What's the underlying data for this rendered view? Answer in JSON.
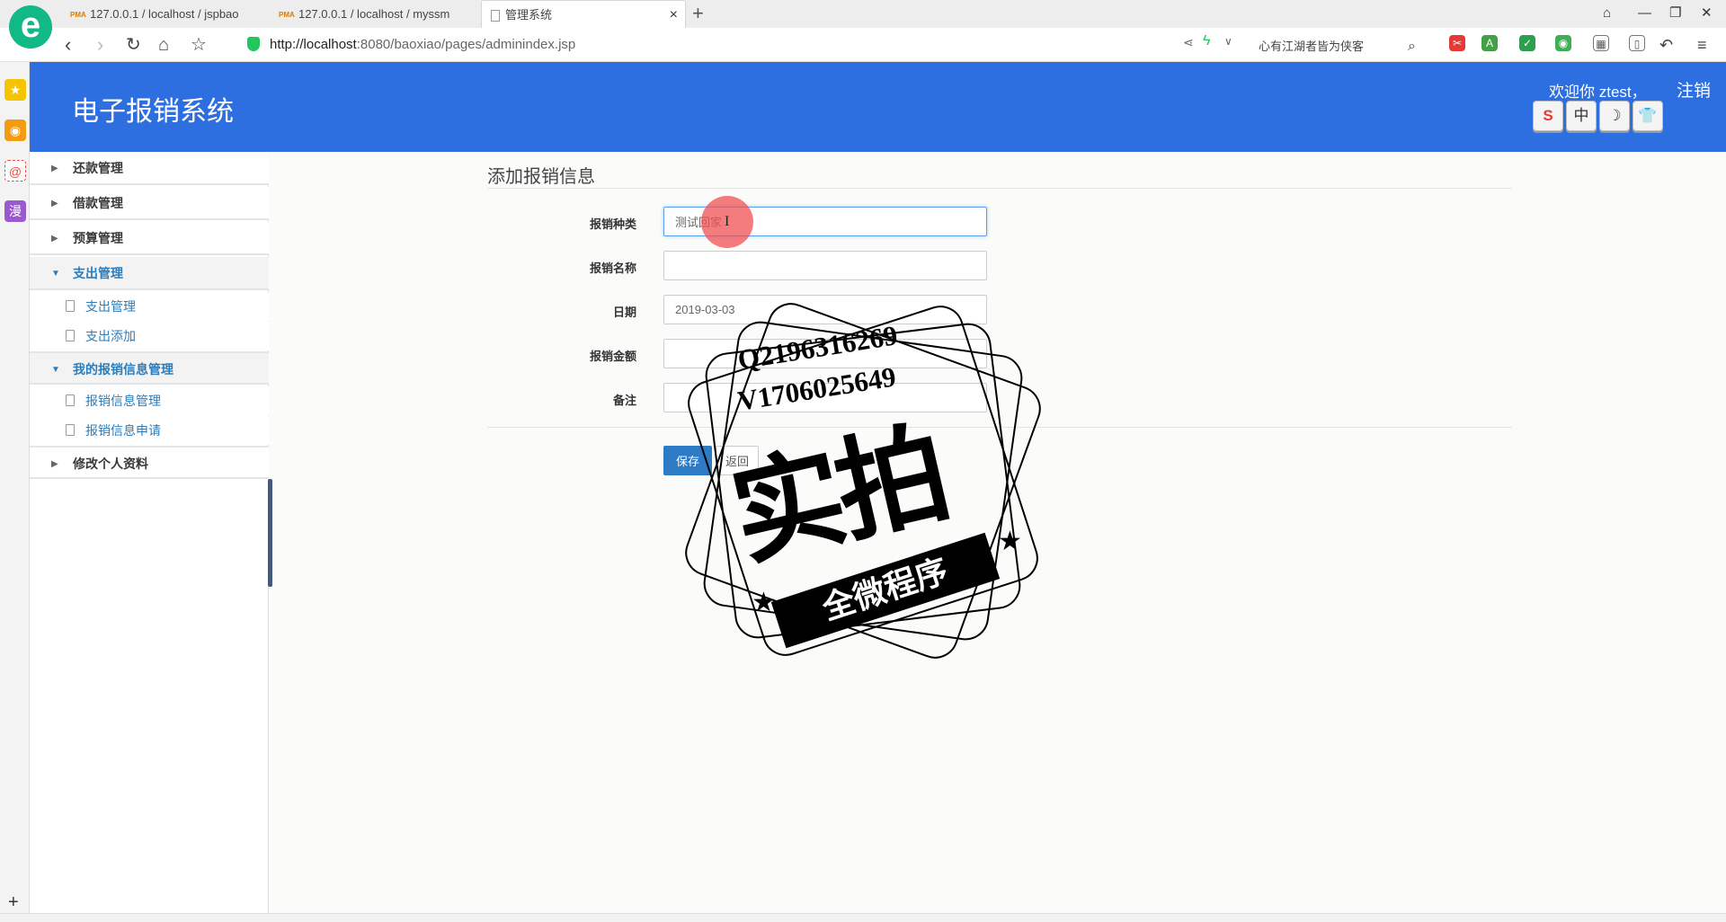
{
  "browser": {
    "tabs": [
      {
        "label": "127.0.0.1 / localhost / jspbao",
        "icon": "pma-icon"
      },
      {
        "label": "127.0.0.1 / localhost / myssm",
        "icon": "pma-icon"
      },
      {
        "label": "管理系统",
        "icon": "page-icon"
      }
    ],
    "close_glyph": "×",
    "new_tab_glyph": "+",
    "url_host": "http://localhost",
    "url_path": ":8080/baoxiao/pages/adminindex.jsp",
    "search_hint": "心有江湖者皆为侠客"
  },
  "app": {
    "title": "电子报销系统",
    "welcome": "欢迎你  ztest，",
    "logout": "注销",
    "ime": [
      "S",
      "中",
      "☽",
      "👕"
    ]
  },
  "sidebar": {
    "groups": [
      {
        "label": "还款管理"
      },
      {
        "label": "借款管理"
      },
      {
        "label": "预算管理"
      },
      {
        "label": "支出管理",
        "items": [
          "支出管理",
          "支出添加"
        ]
      },
      {
        "label": "我的报销信息管理",
        "items": [
          "报销信息管理",
          "报销信息申请"
        ]
      },
      {
        "label": "修改个人资料"
      }
    ]
  },
  "form": {
    "title": "添加报销信息",
    "fields": [
      {
        "label": "报销种类",
        "value": "测试回家"
      },
      {
        "label": "报销名称",
        "value": ""
      },
      {
        "label": "日期",
        "value": "2019-03-03"
      },
      {
        "label": "报销金额",
        "value": ""
      },
      {
        "label": "备注",
        "value": ""
      }
    ],
    "save": "保存",
    "back": "返回"
  },
  "watermark": {
    "line1": "Q2196316269",
    "line2": "V1706025649",
    "big": "实拍",
    "banner": "全微程序"
  },
  "colors": {
    "header": "#2d6fe0",
    "accent": "#2b7dbc",
    "save_button": "#2d7ac5"
  }
}
